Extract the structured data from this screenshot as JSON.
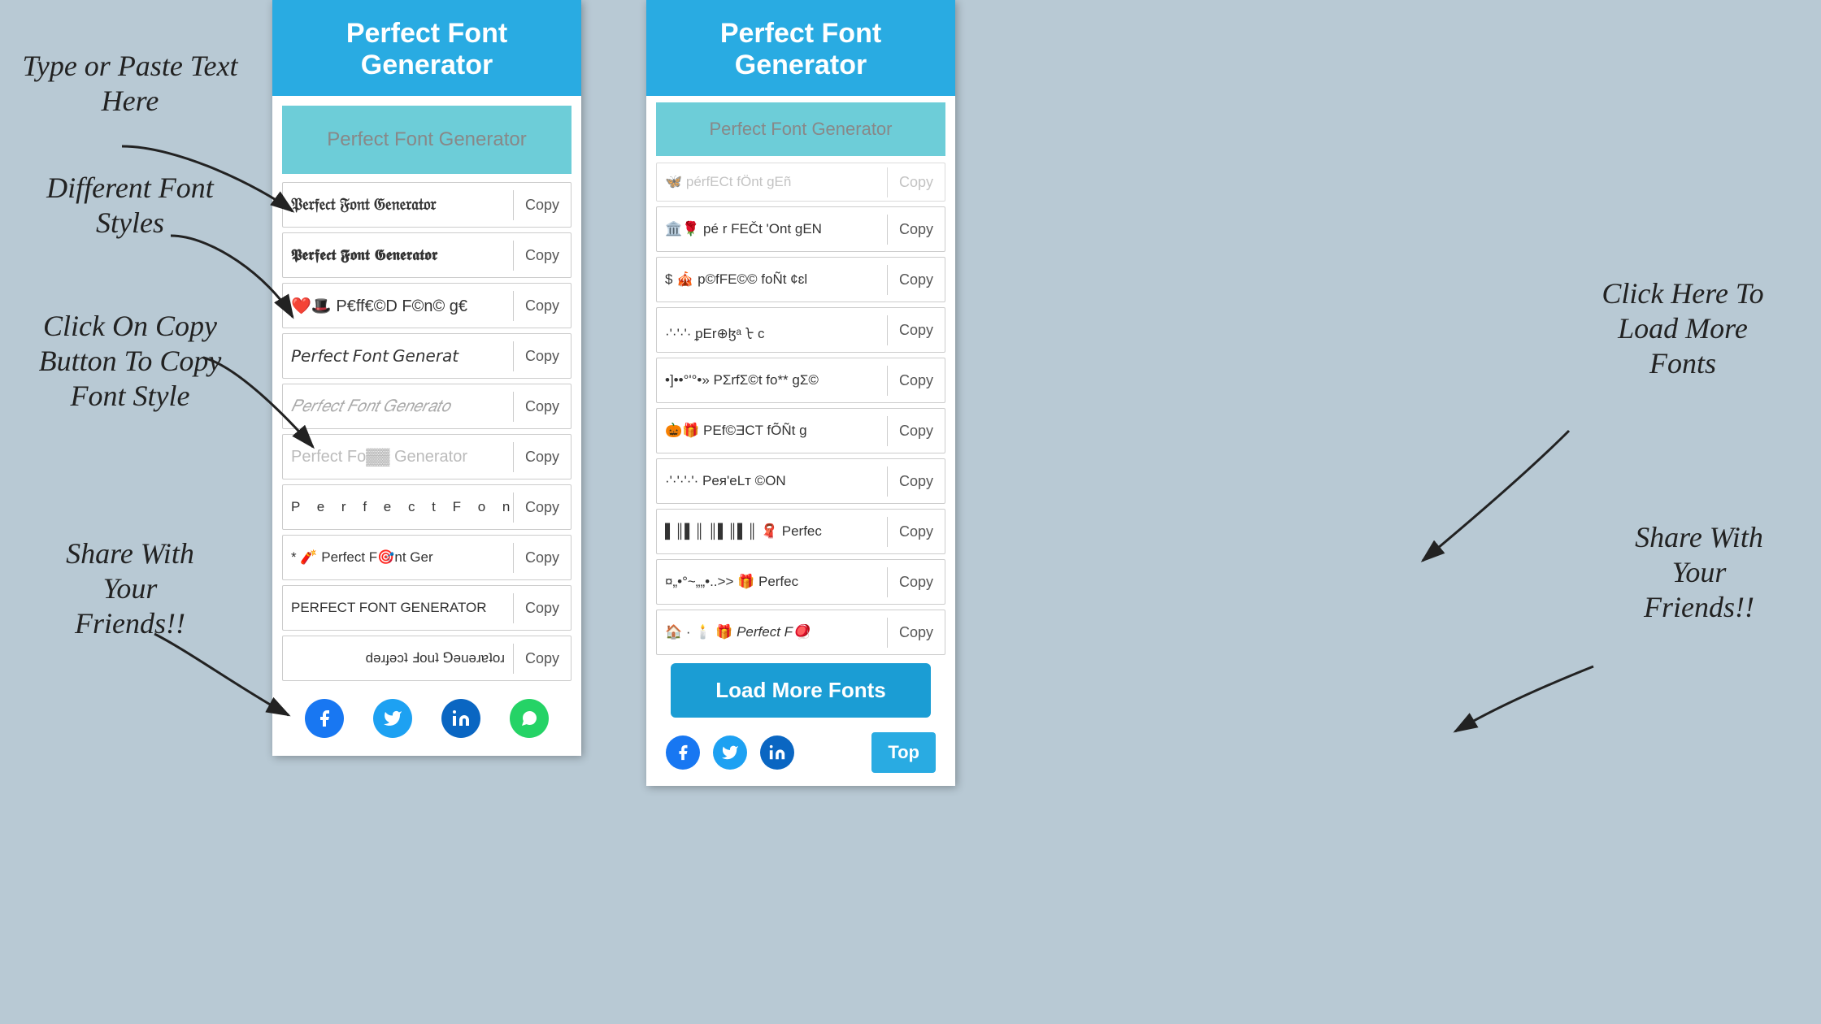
{
  "page": {
    "background": "#b8c9d4"
  },
  "annotations": {
    "type_paste": "Type or Paste Text\nHere",
    "different_fonts": "Different Font\nStyles",
    "click_copy": "Click On Copy\nButton To Copy\nFont Style",
    "share": "Share With\nYour\nFriends!!",
    "load_more_annotation": "Click Here To\nLoad More\nFonts",
    "share_right": "Share With\nYour\nFriends!!"
  },
  "left_phone": {
    "header": "Perfect Font Generator",
    "input_placeholder": "Perfect Font Generator",
    "font_rows": [
      {
        "text": "𝔓𝔢𝔯𝔣𝔢𝔠𝔱 𝔉𝔬𝔫𝔱 𝔊𝔢𝔫𝔢𝔯𝔞𝔱𝔬𝔯",
        "style": "gothic",
        "copy": "Copy"
      },
      {
        "text": "𝕻𝖊𝖗𝖋𝖊𝖈𝖙 𝕱𝖔𝖓𝖙 𝕲𝖊𝖓𝖊𝖗𝖆𝖙𝖔𝖗",
        "style": "bold-gothic",
        "copy": "Copy"
      },
      {
        "text": "❤️🎩 P€ff€©  F©n© g€",
        "style": "emoji",
        "copy": "Copy"
      },
      {
        "text": "𝘗𝘦𝘳𝘧𝘦𝘤𝘵 𝘍𝘰𝘯𝘵 𝘎𝘦𝘯𝘦𝘳𝘢𝘵",
        "style": "italic-sans",
        "copy": "Copy"
      },
      {
        "text": "𝑃𝑒𝑟𝑓𝑒𝑐𝑡 𝐹𝑜𝑛𝑡 𝐺𝑒𝑛𝑒𝑟𝑎𝑡𝑜",
        "style": "italic-serif",
        "copy": "Copy"
      },
      {
        "text": "Perfect Fo▓▓ Generator",
        "style": "strikethrough",
        "copy": "Copy"
      },
      {
        "text": "P  e  r  f  e  c  t   F  o  n  t",
        "style": "spaced",
        "copy": "Copy"
      },
      {
        "text": "* 🧨 Perfect F🎯nt Ger",
        "style": "emoji2",
        "copy": "Copy"
      },
      {
        "text": "PERFECT FONT GENERATOR",
        "style": "caps",
        "copy": "Copy"
      },
      {
        "text": "ɹoʇɐɹǝuǝ⅁ ʇuoℲ ʇɔǝɟɹǝd",
        "style": "reversed",
        "copy": "Copy"
      }
    ],
    "social": {
      "facebook": "f",
      "twitter": "🐦",
      "linkedin": "in",
      "whatsapp": "W"
    }
  },
  "right_phone": {
    "header": "Perfect Font Generator",
    "input_placeholder": "Perfect Font Generator",
    "font_rows": [
      {
        "text": "🦋🌹 pérfECt 'Ont gEN",
        "style": "emoji",
        "copy": "Copy"
      },
      {
        "text": "$ 🎪 p©fFE©© foÑt ¢ɛl",
        "style": "emoji2",
        "copy": "Copy"
      },
      {
        "text": "·'·'·'·  ᵱEr⊕ɮᵃ ᡶ c",
        "style": "special",
        "copy": "Copy"
      },
      {
        "text": "•]••°'°•»  PΣrfΣ©t fo** gΣ©",
        "style": "special2",
        "copy": "Copy"
      },
      {
        "text": "🎃🎁 PEf©ƎCT fÕÑt g",
        "style": "emoji3",
        "copy": "Copy"
      },
      {
        "text": "·'·'·'·'·  Peя'eLт ©ON",
        "style": "special3",
        "copy": "Copy"
      },
      {
        "text": "▌║▌║ ║▌║▌║  🧣 Perfec",
        "style": "barcode",
        "copy": "Copy"
      },
      {
        "text": "¤„•°~„„•..>>  🎁 Perfec",
        "style": "special4",
        "copy": "Copy"
      },
      {
        "text": "🏠 · 🕯️ 🎁 Perfect F🪀",
        "style": "emoji4",
        "copy": "Copy"
      }
    ],
    "load_more": "Load More Fonts",
    "top_btn": "Top",
    "social": {
      "facebook": "f",
      "twitter": "🐦",
      "linkedin": "in"
    }
  },
  "copy_label": "Copy"
}
